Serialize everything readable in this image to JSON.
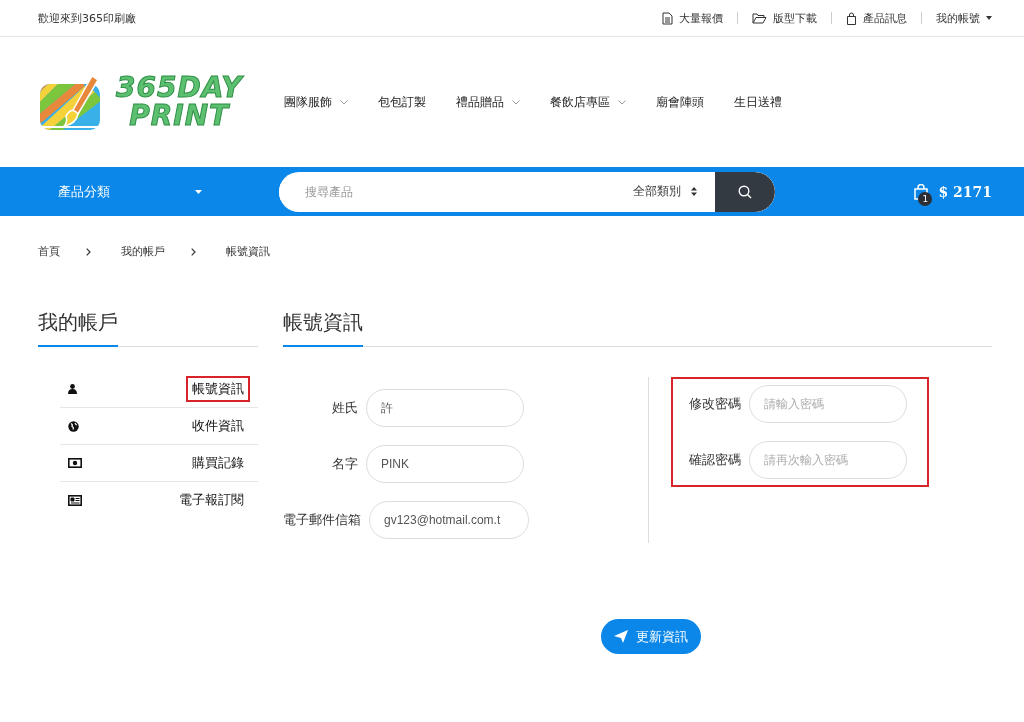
{
  "top_bar": {
    "welcome": "歡迎來到365印刷廠",
    "links": [
      {
        "kind": "doc",
        "label": "大量報價"
      },
      {
        "kind": "folder",
        "label": "版型下載"
      },
      {
        "kind": "bag",
        "label": "產品訊息"
      },
      {
        "kind": "menu",
        "label": "我的帳號"
      }
    ]
  },
  "logo": {
    "line_1": "365DAY",
    "line_2": "PRINT"
  },
  "nav": [
    {
      "label": "團隊服飾",
      "dropdown": true
    },
    {
      "label": "包包訂製",
      "dropdown": false
    },
    {
      "label": "禮品贈品",
      "dropdown": true
    },
    {
      "label": "餐飲店專區",
      "dropdown": true
    },
    {
      "label": "廟會陣頭",
      "dropdown": false
    },
    {
      "label": "生日送禮",
      "dropdown": false
    }
  ],
  "category_bar": {
    "label": "產品分類",
    "search_placeholder": "搜尋產品",
    "category_select": "全部類別",
    "cart_count": "1",
    "cart_total": "$ 2171"
  },
  "breadcrumb": [
    "首頁",
    "我的帳戶",
    "帳號資訊"
  ],
  "sidebar": {
    "title": "我的帳戶",
    "items": [
      {
        "kind": "user",
        "label": "帳號資訊",
        "highlighted": true
      },
      {
        "kind": "globe",
        "label": "收件資訊",
        "highlighted": false
      },
      {
        "kind": "money",
        "label": "購買記錄",
        "highlighted": false
      },
      {
        "kind": "news",
        "label": "電子報訂閱",
        "highlighted": false
      }
    ]
  },
  "content": {
    "title": "帳號資訊",
    "profile_fields": [
      {
        "label": "姓氏",
        "value": "許"
      },
      {
        "label": "名字",
        "value": "PINK"
      },
      {
        "label": "電子郵件信箱",
        "value": "gv123@hotmail.com.t"
      }
    ],
    "password_section": {
      "highlighted": true,
      "fields": [
        {
          "label": "修改密碼",
          "placeholder": "請輸入密碼"
        },
        {
          "label": "確認密碼",
          "placeholder": "請再次輸入密碼"
        }
      ]
    },
    "submit_button": "更新資訊"
  }
}
